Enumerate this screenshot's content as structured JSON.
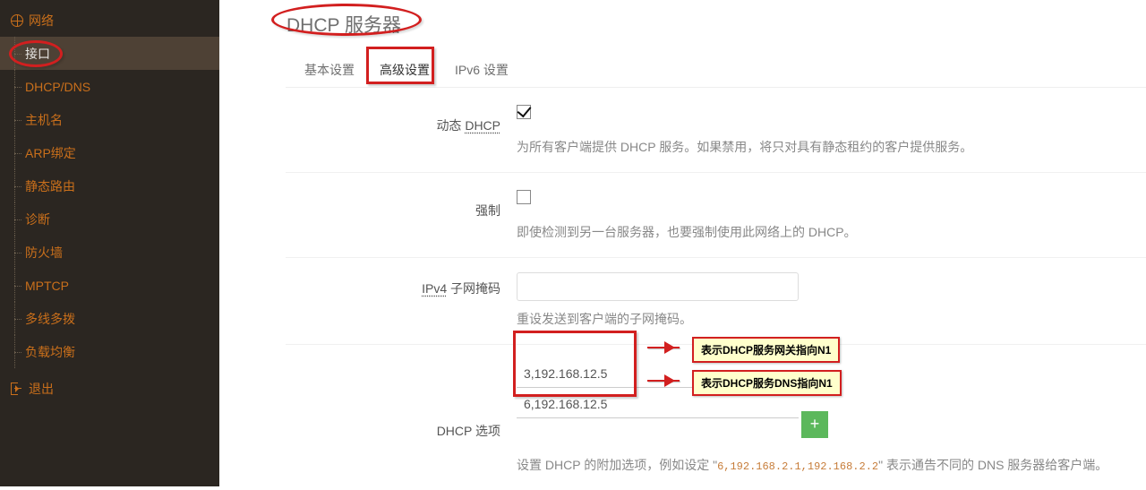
{
  "sidebar": {
    "top_label": "网络",
    "items": [
      {
        "label": "接口",
        "active": true
      },
      {
        "label": "DHCP/DNS"
      },
      {
        "label": "主机名"
      },
      {
        "label": "ARP绑定"
      },
      {
        "label": "静态路由"
      },
      {
        "label": "诊断"
      },
      {
        "label": "防火墙"
      },
      {
        "label": "MPTCP"
      },
      {
        "label": "多线多拨"
      },
      {
        "label": "负载均衡"
      }
    ],
    "logout": "退出"
  },
  "page": {
    "title": "DHCP 服务器",
    "tabs": [
      "基本设置",
      "高级设置",
      "IPv6 设置"
    ],
    "active_tab": 1,
    "fields": {
      "dynamic_dhcp": {
        "label_prefix": "动态 ",
        "label_underlined": "DHCP",
        "checked": true,
        "hint": "为所有客户端提供 DHCP 服务。如果禁用，将只对具有静态租约的客户提供服务。"
      },
      "force": {
        "label": "强制",
        "checked": false,
        "hint": "即使检测到另一台服务器，也要强制使用此网络上的 DHCP。"
      },
      "netmask": {
        "label_underlined": "IPv4",
        "label_suffix": " 子网掩码",
        "value": "",
        "hint": "重设发送到客户端的子网掩码。"
      },
      "dhcp_options": {
        "label": "DHCP 选项",
        "values": [
          "3,192.168.12.5",
          "6,192.168.12.5"
        ],
        "add_symbol": "+",
        "hint_parts": {
          "before": "设置 DHCP 的附加选项，例如设定 \"",
          "code": "6,192.168.2.1,192.168.2.2",
          "after": "\" 表示通告不同的 DNS 服务器给客户端。"
        }
      }
    }
  },
  "annotations": {
    "callout1": "表示DHCP服务网关指向N1",
    "callout2": "表示DHCP服务DNS指向N1"
  }
}
